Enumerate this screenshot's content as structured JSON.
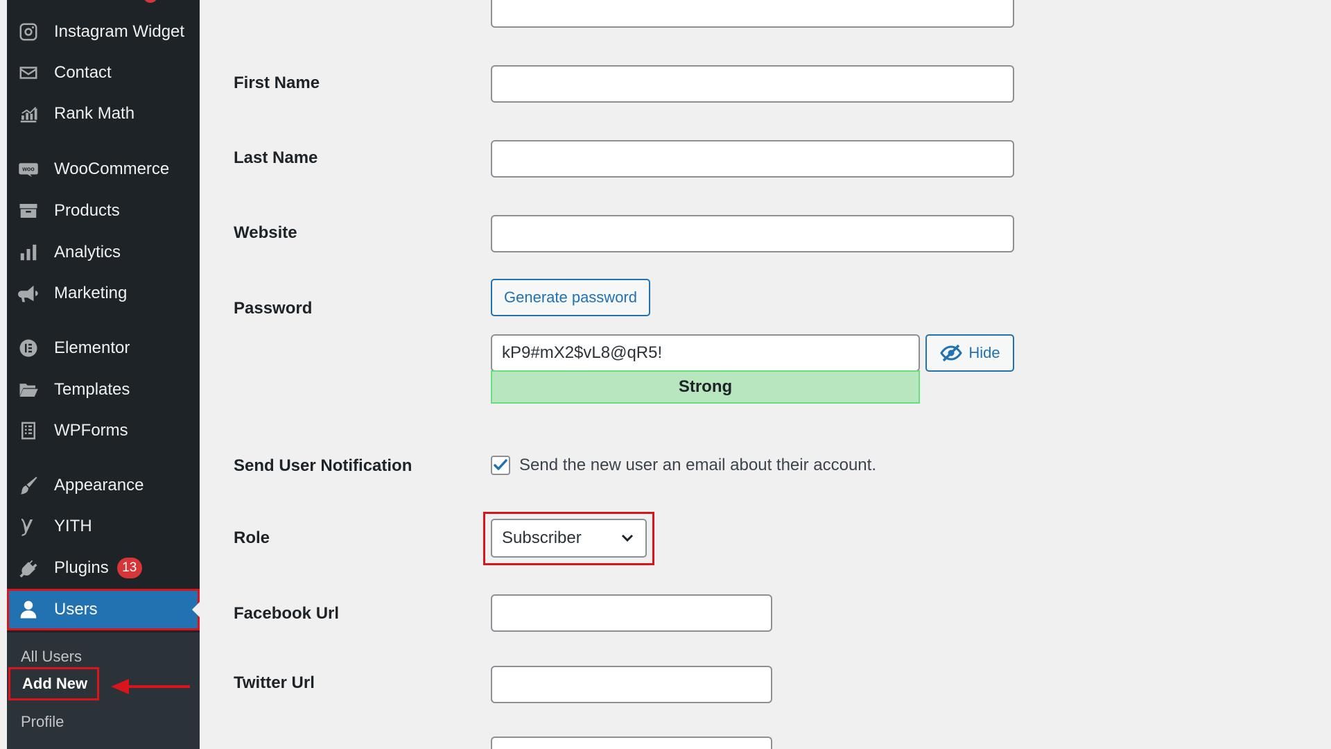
{
  "sidebar": {
    "items": [
      {
        "label": "Instagram Widget",
        "icon": "instagram-icon"
      },
      {
        "label": "Contact",
        "icon": "envelope-icon"
      },
      {
        "label": "Rank Math",
        "icon": "chart-icon"
      },
      {
        "label": "WooCommerce",
        "icon": "woo-icon"
      },
      {
        "label": "Products",
        "icon": "archive-icon"
      },
      {
        "label": "Analytics",
        "icon": "bar-chart-icon"
      },
      {
        "label": "Marketing",
        "icon": "megaphone-icon"
      },
      {
        "label": "Elementor",
        "icon": "elementor-icon"
      },
      {
        "label": "Templates",
        "icon": "folder-icon"
      },
      {
        "label": "WPForms",
        "icon": "form-icon"
      },
      {
        "label": "Appearance",
        "icon": "paintbrush-icon"
      },
      {
        "label": "YITH",
        "icon": "yith-icon"
      },
      {
        "label": "Plugins",
        "icon": "plugin-icon",
        "badge": "13"
      },
      {
        "label": "Users",
        "icon": "user-icon",
        "active": true
      }
    ],
    "submenu": {
      "all_users": "All Users",
      "add_new": "Add New",
      "profile": "Profile"
    }
  },
  "form": {
    "first_name": {
      "label": "First Name",
      "value": ""
    },
    "last_name": {
      "label": "Last Name",
      "value": ""
    },
    "website": {
      "label": "Website",
      "value": ""
    },
    "password": {
      "label": "Password",
      "generate_button": "Generate password",
      "value": "kP9#mX2$vL8@qR5!",
      "hide_button": "Hide",
      "strength": "Strong"
    },
    "notification": {
      "label": "Send User Notification",
      "checkbox_label": "Send the new user an email about their account.",
      "checked": true
    },
    "role": {
      "label": "Role",
      "selected": "Subscriber"
    },
    "facebook_url": {
      "label": "Facebook Url",
      "value": ""
    },
    "twitter_url": {
      "label": "Twitter Url",
      "value": ""
    }
  },
  "colors": {
    "sidebar_bg": "#1d2327",
    "active_blue": "#2271b1",
    "highlight_red": "#d9141b",
    "badge_red": "#d63638",
    "strength_green": "#b8e6bf"
  }
}
